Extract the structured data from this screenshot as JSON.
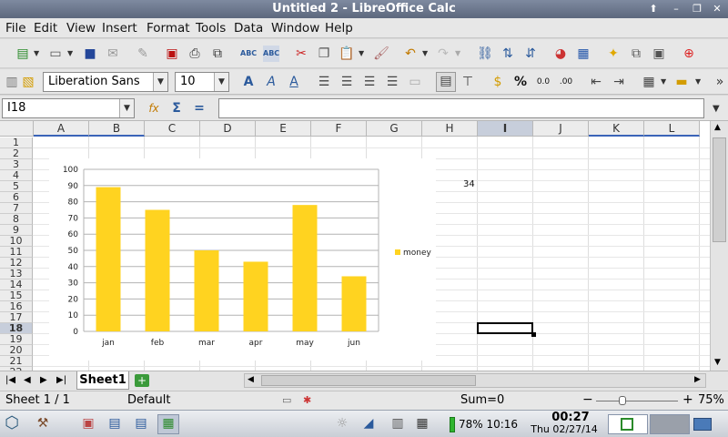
{
  "window": {
    "title": "Untitled 2 - LibreOffice Calc"
  },
  "menu": [
    "File",
    "Edit",
    "View",
    "Insert",
    "Format",
    "Tools",
    "Data",
    "Window",
    "Help"
  ],
  "format_toolbar": {
    "font_name": "Liberation Sans",
    "font_size": "10"
  },
  "formula_bar": {
    "cell_ref": "I18",
    "content": ""
  },
  "columns": [
    "A",
    "B",
    "C",
    "D",
    "E",
    "F",
    "G",
    "H",
    "I",
    "J",
    "K",
    "L"
  ],
  "rows": [
    "1",
    "2",
    "3",
    "4",
    "5",
    "6",
    "7",
    "8",
    "9",
    "10",
    "11",
    "12",
    "13",
    "14",
    "15",
    "16",
    "17",
    "18",
    "19",
    "20",
    "21",
    "22"
  ],
  "cells": {
    "H5": "34"
  },
  "selected_cell": "I18",
  "chart_data": {
    "type": "bar",
    "categories": [
      "jan",
      "feb",
      "mar",
      "apr",
      "may",
      "jun"
    ],
    "series": [
      {
        "name": "money",
        "values": [
          89,
          75,
          50,
          43,
          78,
          34
        ],
        "color": "#ffd320"
      }
    ],
    "ylim": [
      0,
      100
    ],
    "yticks": [
      "0",
      "10",
      "20",
      "30",
      "40",
      "50",
      "60",
      "70",
      "80",
      "90",
      "100"
    ],
    "grid": true,
    "legend_position": "right"
  },
  "sheet_tabs": [
    "Sheet1"
  ],
  "status": {
    "sheet": "Sheet 1 / 1",
    "style": "Default",
    "sum": "Sum=0",
    "zoom": "75%"
  },
  "taskbar": {
    "battery": "78% 10:16",
    "clock_time": "00:27",
    "clock_date": "Thu 02/27/14"
  }
}
